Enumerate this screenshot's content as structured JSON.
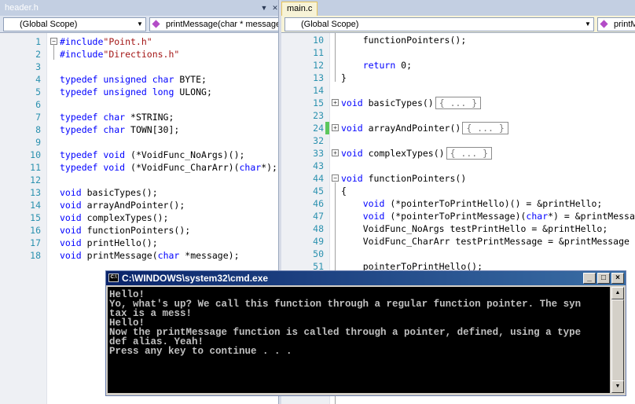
{
  "left_pane": {
    "tab_title": "header.h",
    "scope_combo": "(Global Scope)",
    "member_combo": "printMessage(char * message)",
    "lines": [
      {
        "n": "1",
        "segs": [
          {
            "t": "#include",
            "c": "kw"
          },
          {
            "t": "\"Point.h\"",
            "c": "str"
          }
        ],
        "fold": "−"
      },
      {
        "n": "2",
        "segs": [
          {
            "t": "#include",
            "c": "kw"
          },
          {
            "t": "\"Directions.h\"",
            "c": "str"
          }
        ]
      },
      {
        "n": "3",
        "segs": []
      },
      {
        "n": "4",
        "segs": [
          {
            "t": "typedef unsigned char",
            "c": "kw"
          },
          {
            "t": " BYTE;",
            "c": ""
          }
        ]
      },
      {
        "n": "5",
        "segs": [
          {
            "t": "typedef unsigned long",
            "c": "kw"
          },
          {
            "t": " ULONG;",
            "c": ""
          }
        ]
      },
      {
        "n": "6",
        "segs": []
      },
      {
        "n": "7",
        "segs": [
          {
            "t": "typedef char",
            "c": "kw"
          },
          {
            "t": " *STRING;",
            "c": ""
          }
        ]
      },
      {
        "n": "8",
        "segs": [
          {
            "t": "typedef char",
            "c": "kw"
          },
          {
            "t": " TOWN[30];",
            "c": ""
          }
        ]
      },
      {
        "n": "9",
        "segs": []
      },
      {
        "n": "10",
        "segs": [
          {
            "t": "typedef void",
            "c": "kw"
          },
          {
            "t": " (*VoidFunc_NoArgs)();",
            "c": ""
          }
        ]
      },
      {
        "n": "11",
        "segs": [
          {
            "t": "typedef void",
            "c": "kw"
          },
          {
            "t": " (*VoidFunc_CharArr)(",
            "c": ""
          },
          {
            "t": "char",
            "c": "kw"
          },
          {
            "t": "*);",
            "c": ""
          }
        ]
      },
      {
        "n": "12",
        "segs": []
      },
      {
        "n": "13",
        "segs": [
          {
            "t": "void",
            "c": "kw"
          },
          {
            "t": " basicTypes();",
            "c": ""
          }
        ]
      },
      {
        "n": "14",
        "segs": [
          {
            "t": "void",
            "c": "kw"
          },
          {
            "t": " arrayAndPointer();",
            "c": ""
          }
        ]
      },
      {
        "n": "15",
        "segs": [
          {
            "t": "void",
            "c": "kw"
          },
          {
            "t": " complexTypes();",
            "c": ""
          }
        ]
      },
      {
        "n": "16",
        "segs": [
          {
            "t": "void",
            "c": "kw"
          },
          {
            "t": " functionPointers();",
            "c": ""
          }
        ]
      },
      {
        "n": "17",
        "segs": [
          {
            "t": "void",
            "c": "kw"
          },
          {
            "t": " printHello();",
            "c": ""
          }
        ]
      },
      {
        "n": "18",
        "segs": [
          {
            "t": "void",
            "c": "kw"
          },
          {
            "t": " printMessage(",
            "c": ""
          },
          {
            "t": "char",
            "c": "kw"
          },
          {
            "t": " *message);",
            "c": ""
          }
        ]
      }
    ]
  },
  "right_pane": {
    "tab_title": "main.c",
    "scope_combo": "(Global Scope)",
    "member_combo": "printM",
    "lines": [
      {
        "n": "10",
        "segs": [
          {
            "t": "    functionPointers();",
            "c": ""
          }
        ]
      },
      {
        "n": "11",
        "segs": []
      },
      {
        "n": "12",
        "segs": [
          {
            "t": "    ",
            "c": ""
          },
          {
            "t": "return",
            "c": "kw"
          },
          {
            "t": " 0;",
            "c": ""
          }
        ]
      },
      {
        "n": "13",
        "segs": [
          {
            "t": "}",
            "c": ""
          }
        ]
      },
      {
        "n": "14",
        "segs": []
      },
      {
        "n": "15",
        "segs": [
          {
            "t": "void",
            "c": "kw"
          },
          {
            "t": " basicTypes()",
            "c": ""
          }
        ],
        "fold": "+",
        "collapsed": "{ ... }"
      },
      {
        "n": "23",
        "segs": []
      },
      {
        "n": "24",
        "segs": [
          {
            "t": "void",
            "c": "kw"
          },
          {
            "t": " arrayAndPointer()",
            "c": ""
          }
        ],
        "fold": "+",
        "collapsed": "{ ... }",
        "changed": true
      },
      {
        "n": "32",
        "segs": []
      },
      {
        "n": "33",
        "segs": [
          {
            "t": "void",
            "c": "kw"
          },
          {
            "t": " complexTypes()",
            "c": ""
          }
        ],
        "fold": "+",
        "collapsed": "{ ... }"
      },
      {
        "n": "43",
        "segs": []
      },
      {
        "n": "44",
        "segs": [
          {
            "t": "void",
            "c": "kw"
          },
          {
            "t": " functionPointers()",
            "c": ""
          }
        ],
        "fold": "−"
      },
      {
        "n": "45",
        "segs": [
          {
            "t": "{",
            "c": ""
          }
        ]
      },
      {
        "n": "46",
        "segs": [
          {
            "t": "    ",
            "c": ""
          },
          {
            "t": "void",
            "c": "kw"
          },
          {
            "t": " (*pointerToPrintHello)() = &printHello;",
            "c": ""
          }
        ]
      },
      {
        "n": "47",
        "segs": [
          {
            "t": "    ",
            "c": ""
          },
          {
            "t": "void",
            "c": "kw"
          },
          {
            "t": " (*pointerToPrintMessage)(",
            "c": ""
          },
          {
            "t": "char",
            "c": "kw"
          },
          {
            "t": "*) = &printMessa",
            "c": ""
          }
        ]
      },
      {
        "n": "48",
        "segs": [
          {
            "t": "    VoidFunc_NoArgs testPrintHello = &printHello;",
            "c": ""
          }
        ]
      },
      {
        "n": "49",
        "segs": [
          {
            "t": "    VoidFunc_CharArr testPrintMessage = &printMessage",
            "c": ""
          }
        ]
      },
      {
        "n": "50",
        "segs": []
      },
      {
        "n": "51",
        "segs": [
          {
            "t": "    pointerToPrintHello();",
            "c": ""
          }
        ]
      }
    ]
  },
  "console": {
    "title": "C:\\WINDOWS\\system32\\cmd.exe",
    "icon_label": "C:\\",
    "buttons": {
      "minimize": "_",
      "maximize": "□",
      "close": "×"
    },
    "lines": [
      "Hello!",
      "Yo, what's up? We call this function through a regular function pointer. The syn",
      "tax is a mess!",
      "Hello!",
      "Now the printMessage function is called through a pointer, defined, using a type",
      "def alias. Yeah!",
      "Press any key to continue . . ."
    ]
  }
}
